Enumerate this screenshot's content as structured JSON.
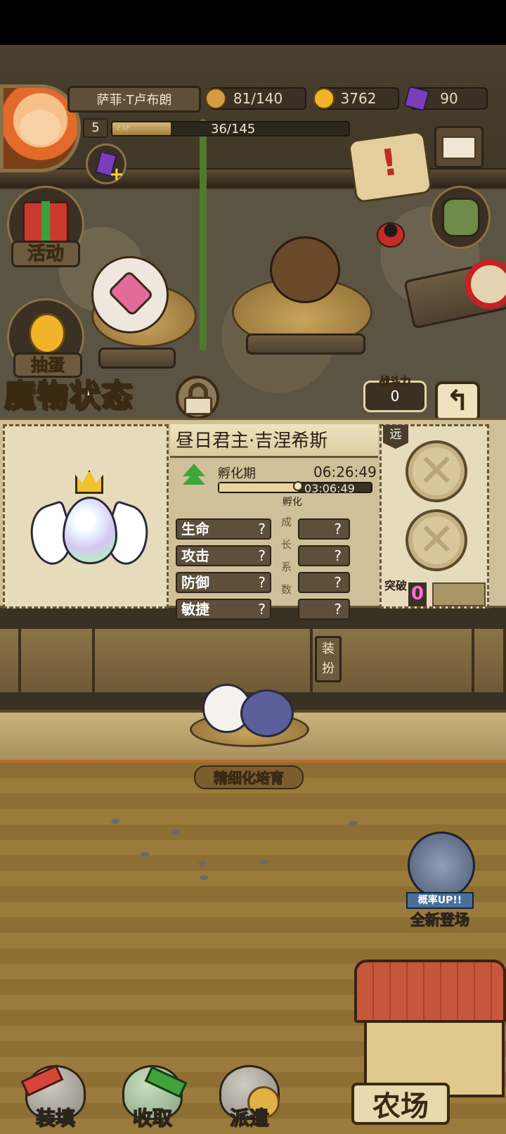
{
  "player": {
    "name": "萨菲·T卢布朗",
    "level": "5",
    "exp_label": "EXP",
    "exp_text": "36/145",
    "exp_fraction": 0.248
  },
  "resources": {
    "stamina": "81/140",
    "gold": "3762",
    "gems": "90"
  },
  "menu": {
    "activity": "活动",
    "gacha": "抽蛋"
  },
  "status": {
    "title": "魔物状态",
    "power_label": "战斗力",
    "power_value": "0",
    "back_icon": "↰",
    "monster_name": "昼日君主·吉涅希斯",
    "hatch_label": "孵化期",
    "hatch_total": "06:26:49",
    "hatch_remaining": "03:06:49",
    "hatch_progress": 0.52,
    "hatch_small": "孵化",
    "stats": [
      {
        "label": "生命",
        "value": "?",
        "growth": "?"
      },
      {
        "label": "攻击",
        "value": "?",
        "growth": "?"
      },
      {
        "label": "防御",
        "value": "?",
        "growth": "?"
      },
      {
        "label": "敏捷",
        "value": "?",
        "growth": "?"
      }
    ],
    "growth_chars": [
      "成",
      "长",
      "系",
      "数"
    ],
    "range_tag": "远",
    "slot_icon": "✕",
    "breakthrough_label": "突破",
    "breakthrough_value": "0"
  },
  "dress": "装扮",
  "training": "精细化培育",
  "banner": {
    "rate": "概率UP!!",
    "text": "全新登场"
  },
  "bottom": {
    "load": "装填",
    "collect": "收取",
    "dispatch": "派遣",
    "farm": "农场"
  },
  "colors": {
    "accent_green": "#3ea73a",
    "gem_purple": "#7a3fb8",
    "break_pink": "#ff6ad5"
  }
}
